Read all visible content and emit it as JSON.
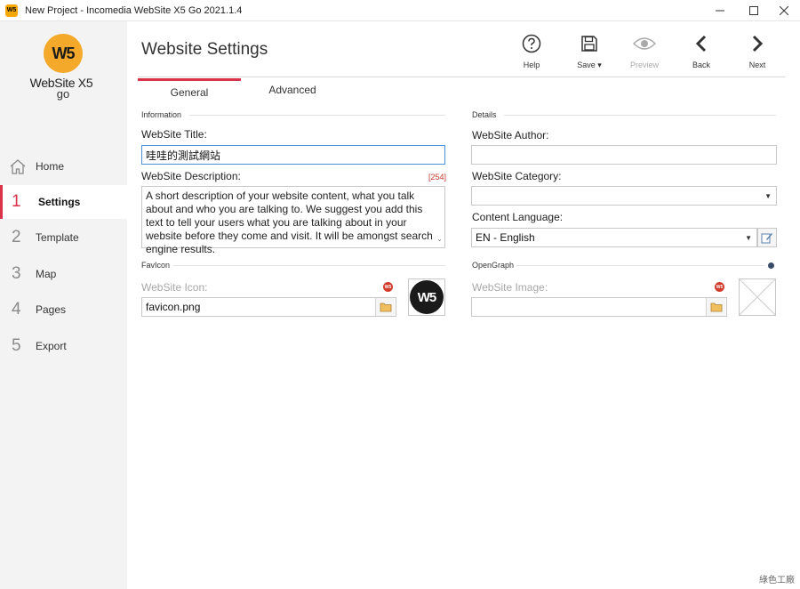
{
  "window": {
    "title": "New Project - Incomedia WebSite X5 Go 2021.1.4",
    "app_icon_text": "W5",
    "controls": [
      "minimize",
      "maximize",
      "close"
    ]
  },
  "sidebar": {
    "logo": {
      "mark": "W5",
      "name": "WebSite X5",
      "edition": "go"
    },
    "items": [
      {
        "num": "",
        "label": "Home",
        "icon": "home-icon"
      },
      {
        "num": "1",
        "label": "Settings",
        "active": true
      },
      {
        "num": "2",
        "label": "Template"
      },
      {
        "num": "3",
        "label": "Map"
      },
      {
        "num": "4",
        "label": "Pages"
      },
      {
        "num": "5",
        "label": "Export"
      }
    ]
  },
  "main": {
    "title": "Website Settings",
    "toolbar": {
      "help": "Help",
      "save": "Save ▾",
      "preview": "Preview",
      "back": "Back",
      "next": "Next"
    },
    "tabs": [
      {
        "label": "General",
        "active": true
      },
      {
        "label": "Advanced"
      }
    ],
    "information": {
      "section": "Information",
      "title_label": "WebSite Title:",
      "title_value": "哇哇的測試網站",
      "description_label": "WebSite Description:",
      "description_counter": "[254]",
      "description_value": "A short description of your website content, what you talk about and who you are talking to. We suggest you add  this text to tell your users what you are talking about in your website before they come and visit. It will be amongst search engine results."
    },
    "details": {
      "section": "Details",
      "author_label": "WebSite Author:",
      "author_value": "",
      "category_label": "WebSite Category:",
      "category_value": "",
      "language_label": "Content Language:",
      "language_value": "EN - English"
    },
    "favicon": {
      "section": "FavIcon",
      "icon_label": "WebSite Icon:",
      "icon_value": "favicon.png",
      "preview_mark": "W5"
    },
    "opengraph": {
      "section": "OpenGraph",
      "image_label": "WebSite Image:",
      "image_value": ""
    }
  },
  "watermark": "綠色工廠",
  "colors": {
    "accent": "#d9334a",
    "logo_orange": "#f4a92b",
    "sidebar_bg": "#f3f3f3",
    "focus_border": "#4a8fd8"
  }
}
